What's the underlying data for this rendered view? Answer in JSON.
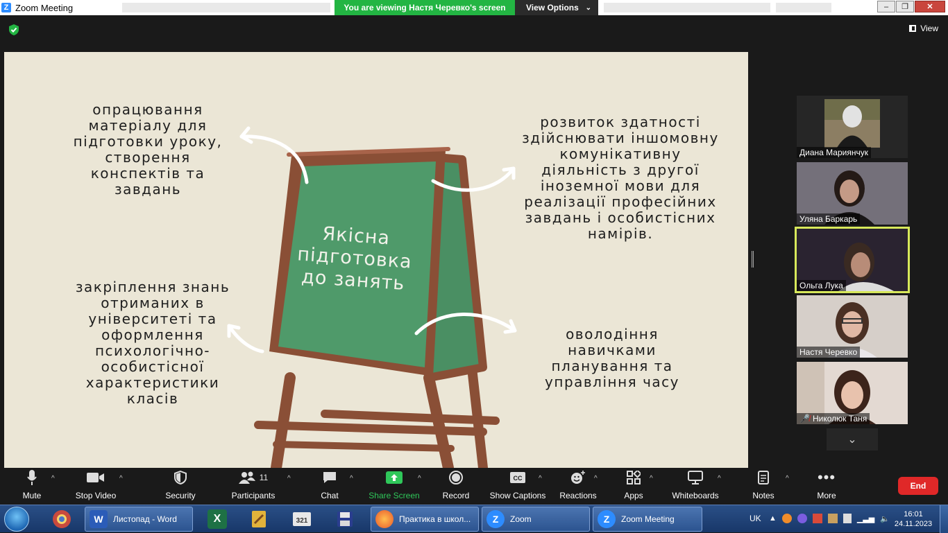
{
  "window": {
    "title": "Zoom Meeting"
  },
  "banner": {
    "viewing": "You are viewing Настя Черевко's screen",
    "view_options": "View Options"
  },
  "topbar": {
    "view_label": "View"
  },
  "slide": {
    "center": "Якісна підготовка до занять",
    "top_left": "опрацювання матеріалу для підготовки уроку, створення конспектів та завдань",
    "top_right": "розвиток здатності здійснювати іншомовну комунікативну діяльність з другої іноземної мови для реалізації професійних завдань і особистісних намірів.",
    "bottom_left": "закріплення знань отриманих в університеті та оформлення психологічно-особистісної характеристики класів",
    "bottom_right": "оволодіння навичками планування та управління часу"
  },
  "participants": [
    {
      "name": "Диана Мариянчук"
    },
    {
      "name": "Уляна Баркарь"
    },
    {
      "name": "Ольга Лука"
    },
    {
      "name": "Настя Черевко"
    },
    {
      "name": "Николюк Таня"
    }
  ],
  "toolbar": {
    "mute": "Mute",
    "stop_video": "Stop Video",
    "security": "Security",
    "participants": "Participants",
    "participants_count": "11",
    "chat": "Chat",
    "share_screen": "Share Screen",
    "record": "Record",
    "show_captions": "Show Captions",
    "reactions": "Reactions",
    "apps": "Apps",
    "whiteboards": "Whiteboards",
    "notes": "Notes",
    "more": "More",
    "end": "End"
  },
  "taskbar": {
    "word": "Листопад - Word",
    "firefox": "Практика в школ...",
    "zoom": "Zoom",
    "zoom_meeting": "Zoom Meeting",
    "lang": "UK",
    "time": "16:01",
    "date": "24.11.2023"
  },
  "colors": {
    "share_green": "#2fc75a",
    "end_red": "#e02828",
    "active_speaker": "#d7e85a",
    "board_green": "#4f9a6a"
  }
}
